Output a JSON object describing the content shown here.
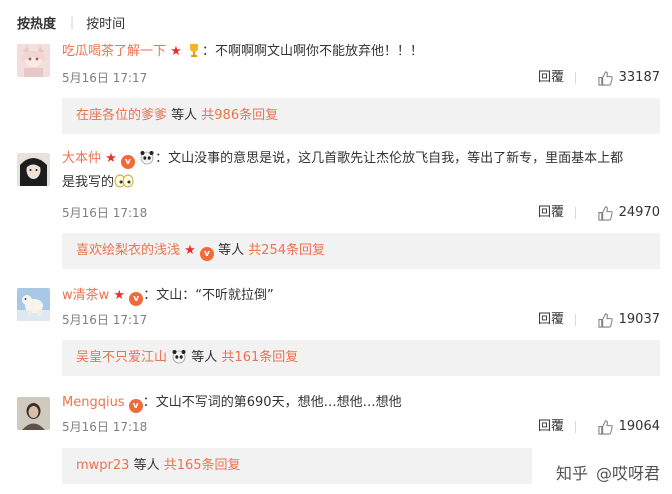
{
  "sort": {
    "active": "按热度",
    "inactive": "按时间"
  },
  "comments": [
    {
      "user": "吃瓜喝茶了解一下",
      "colon": "：",
      "text": "不啊啊啊文山啊你不能放弃他！！！",
      "time": "5月16日 17:17",
      "reply_label": "回覆",
      "likes": "33187",
      "sub_user": "在座各位的爹爹",
      "sub_mid": " 等人 ",
      "sub_count": "共986条回复"
    },
    {
      "user": "大本仲",
      "colon": "：",
      "text": "文山没事的意思是说，这几首歌先让杰伦放飞自我，等出了新专，里面基本上都",
      "text2": "是我写的",
      "time": "5月16日 17:18",
      "reply_label": "回覆",
      "likes": "24970",
      "sub_user": "喜欢绘梨衣的浅浅",
      "sub_mid": " 等人 ",
      "sub_count": "共254条回复"
    },
    {
      "user": "w清茶w",
      "colon": "：",
      "text": "文山：“不听就拉倒”",
      "time": "5月16日 17:17",
      "reply_label": "回覆",
      "likes": "19037",
      "sub_user": "吴皇不只爱江山",
      "sub_mid": " 等人 ",
      "sub_count": "共161条回复"
    },
    {
      "user": "Mengqius",
      "colon": "：",
      "text": "文山不写词的第690天，想他…想他…想他",
      "time": "5月16日 17:18",
      "reply_label": "回覆",
      "likes": "19064",
      "sub_user": "mwpr23",
      "sub_mid": " 等人 ",
      "sub_count": "共165条回复"
    }
  ],
  "watermark": {
    "site": "知乎",
    "author": "@哎呀君"
  },
  "colors": {
    "link": "#eb7350",
    "text": "#333333",
    "meta": "#808080",
    "subbox_bg": "#f2f2f2",
    "star": "#e8302e"
  }
}
